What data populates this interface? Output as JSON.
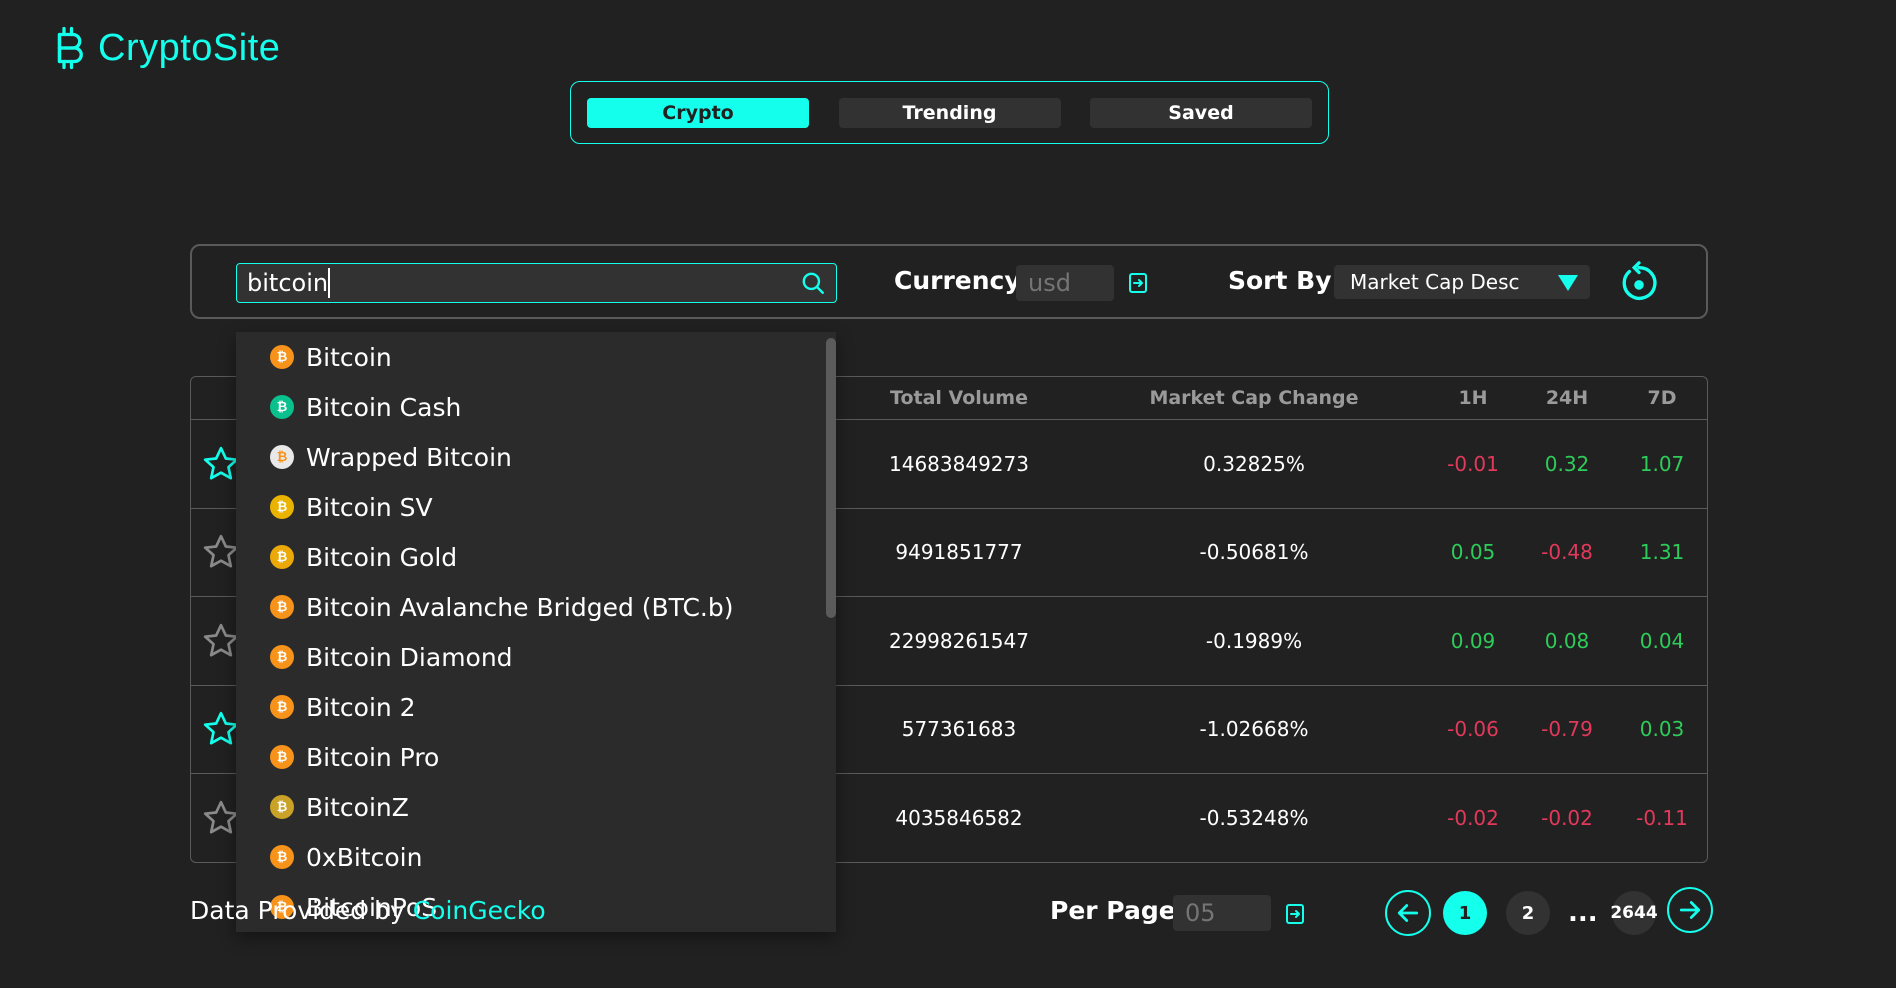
{
  "app": {
    "name": "CryptoSite"
  },
  "nav": {
    "tabs": [
      {
        "label": "Crypto",
        "active": true
      },
      {
        "label": "Trending",
        "active": false
      },
      {
        "label": "Saved",
        "active": false
      }
    ]
  },
  "filters": {
    "search_value": "bitcoin",
    "currency_label": "Currency:",
    "currency_placeholder": "usd",
    "sort_label": "Sort By:",
    "sort_value": "Market Cap Desc"
  },
  "table": {
    "columns": [
      "Total Volume",
      "Market Cap Change",
      "1H",
      "24H",
      "7D"
    ],
    "rows": [
      {
        "saved": true,
        "total_volume": "14683849273",
        "market_cap_change": "0.32825%",
        "h1": "-0.01",
        "h24": "0.32",
        "d7": "1.07"
      },
      {
        "saved": false,
        "total_volume": "9491851777",
        "market_cap_change": "-0.50681%",
        "h1": "0.05",
        "h24": "-0.48",
        "d7": "1.31"
      },
      {
        "saved": false,
        "total_volume": "22998261547",
        "market_cap_change": "-0.1989%",
        "h1": "0.09",
        "h24": "0.08",
        "d7": "0.04"
      },
      {
        "saved": true,
        "total_volume": "577361683",
        "market_cap_change": "-1.02668%",
        "h1": "-0.06",
        "h24": "-0.79",
        "d7": "0.03"
      },
      {
        "saved": false,
        "total_volume": "4035846582",
        "market_cap_change": "-0.53248%",
        "h1": "-0.02",
        "h24": "-0.02",
        "d7": "-0.11"
      }
    ]
  },
  "dropdown": {
    "items": [
      {
        "label": "Bitcoin",
        "color": "#f7931a"
      },
      {
        "label": "Bitcoin Cash",
        "color": "#0ac18e"
      },
      {
        "label": "Wrapped Bitcoin",
        "color": "#e8e8e8"
      },
      {
        "label": "Bitcoin SV",
        "color": "#eab300"
      },
      {
        "label": "Bitcoin Gold",
        "color": "#eba809"
      },
      {
        "label": "Bitcoin Avalanche Bridged (BTC.b)",
        "color": "#f7931a"
      },
      {
        "label": "Bitcoin Diamond",
        "color": "#f7931a"
      },
      {
        "label": "Bitcoin 2",
        "color": "#f7931a"
      },
      {
        "label": "Bitcoin Pro",
        "color": "#f7931a"
      },
      {
        "label": "BitcoinZ",
        "color": "#c9a227"
      },
      {
        "label": "0xBitcoin",
        "color": "#f7931a"
      },
      {
        "label": "BitcoinPoS",
        "color": "#f7931a"
      }
    ]
  },
  "footer": {
    "data_provided_prefix": "Data Provided by ",
    "data_provided_source": "CoinGecko",
    "per_page_label": "Per Page:",
    "per_page_placeholder": "05",
    "pages": [
      "1",
      "2",
      "...",
      "2644"
    ]
  },
  "colors": {
    "accent": "#14ffec",
    "positive": "#2ecc5a",
    "negative": "#e2395b",
    "background": "#212121"
  }
}
